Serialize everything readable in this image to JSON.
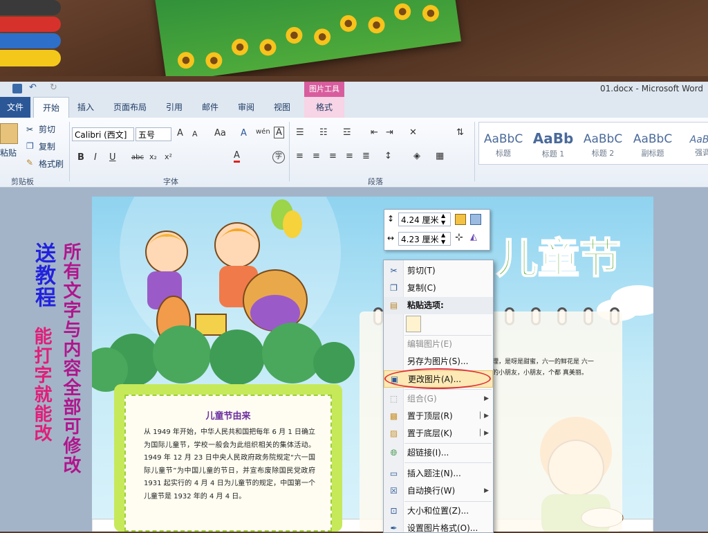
{
  "window": {
    "title": "01.docx - Microsoft Word"
  },
  "quick_access": {
    "save_icon": "save-icon",
    "undo_icon": "undo-icon",
    "redo_icon": "redo-icon"
  },
  "contextual_tab": {
    "group_label": "图片工具",
    "tab_label": "格式",
    "color": "#d85d9e"
  },
  "tabs": [
    "文件",
    "开始",
    "插入",
    "页面布局",
    "引用",
    "邮件",
    "审阅",
    "视图"
  ],
  "active_tab": "开始",
  "clipboard": {
    "paste": "粘贴",
    "cut": "剪切",
    "copy": "复制",
    "format_painter": "格式刷",
    "group": "剪贴板"
  },
  "font": {
    "name": "Calibri (西文]",
    "size": "五号",
    "group": "字体",
    "bold": "B",
    "italic": "I",
    "underline": "U",
    "strike": "abc",
    "sub": "x₂",
    "sup": "x²",
    "color_a": "A",
    "grow": "A",
    "shrink": "A",
    "change_case": "Aa",
    "clear": "A",
    "phonetic": "wén",
    "border_char": "A",
    "enclose": "字"
  },
  "paragraph": {
    "group": "段落"
  },
  "styles": [
    {
      "sample": "AaBbC",
      "name": "标题"
    },
    {
      "sample": "AaBb",
      "name": "标题 1"
    },
    {
      "sample": "AaBbC",
      "name": "标题 2"
    },
    {
      "sample": "AaBbC",
      "name": "副标题"
    },
    {
      "sample": "AaBb",
      "name": "强调"
    }
  ],
  "side_text": {
    "col1": "送教程",
    "col1b": "能打字就能改",
    "col2": "所有文字与内容全部可修改"
  },
  "minibar": {
    "height_value": "4.24 厘米",
    "width_value": "4.23 厘米"
  },
  "context_menu": {
    "items": [
      {
        "label": "剪切(T)",
        "icon": "scissors-icon",
        "enabled": true
      },
      {
        "label": "复制(C)",
        "icon": "copy-icon",
        "enabled": true
      },
      {
        "label": "粘贴选项:",
        "icon": "paste-icon",
        "enabled": true,
        "header": true
      },
      {
        "label": "编辑图片(E)",
        "icon": "",
        "enabled": false
      },
      {
        "label": "另存为图片(S)...",
        "icon": "",
        "enabled": true
      },
      {
        "label": "更改图片(A)...",
        "icon": "change-picture-icon",
        "enabled": true,
        "highlighted": true
      },
      {
        "label": "组合(G)",
        "icon": "group-icon",
        "enabled": false,
        "submenu": true
      },
      {
        "label": "置于顶层(R)",
        "icon": "bring-front-icon",
        "enabled": true,
        "submenu": true
      },
      {
        "label": "置于底层(K)",
        "icon": "send-back-icon",
        "enabled": true,
        "submenu": true
      },
      {
        "label": "超链接(I)...",
        "icon": "hyperlink-icon",
        "enabled": true
      },
      {
        "label": "插入题注(N)...",
        "icon": "caption-icon",
        "enabled": true
      },
      {
        "label": "自动换行(W)",
        "icon": "wrap-icon",
        "enabled": true,
        "submenu": true
      },
      {
        "label": "大小和位置(Z)...",
        "icon": "size-icon",
        "enabled": true
      },
      {
        "label": "设置图片格式(O)...",
        "icon": "format-picture-icon",
        "enabled": true
      }
    ]
  },
  "poster": {
    "title": "儿童节",
    "textbox_title": "儿童节由来",
    "textbox_body": "从 1949 年开始，中华人民共和国把每年 6 月 1 日确立为国际儿童节，学校一般会为此组织相关的集体活动。1949 年 12 月 23 日中央人民政府政务院规定“六一国际儿童节”为中国儿童的节日，并宣布废除国民党政府 1931 起实行的 4 月 4 日为儿童节的规定，中国第一个儿童节是 1932 年的 4 月 4 日。",
    "card_text": "理，是呀是甜蜜，六一的鲜花是 六一的小朋友，小朋友，个都 真美丽。"
  }
}
